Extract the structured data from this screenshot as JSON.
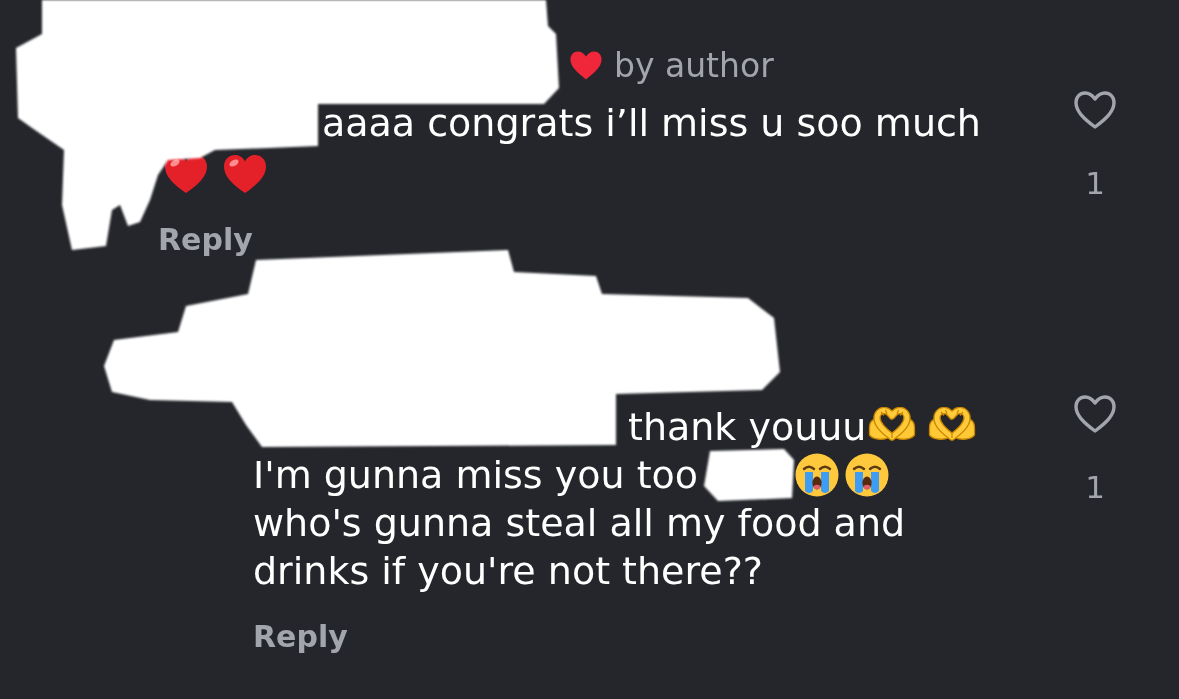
{
  "comments": [
    {
      "name_redacted": true,
      "liked_by_creator": true,
      "liked_by_creator_label": "by author",
      "lines": [
        {
          "segments": [
            {
              "kind": "redacted"
            },
            {
              "kind": "text",
              "text": "aaaa congrats i’ll miss u soo much"
            }
          ]
        },
        {
          "segments": [
            {
              "kind": "red-heart"
            },
            {
              "kind": "red-heart"
            }
          ]
        }
      ],
      "reply_label": "Reply",
      "liked": false,
      "like_count": "1",
      "replies": [
        {
          "name_redacted": true,
          "lines": [
            {
              "segments": [
                {
                  "kind": "redacted"
                },
                {
                  "kind": "text",
                  "text": "thank youuu"
                },
                {
                  "kind": "heart-hands"
                },
                {
                  "kind": "heart-hands"
                }
              ]
            },
            {
              "segments": [
                {
                  "kind": "text",
                  "text": "I'm gunna miss you too"
                },
                {
                  "kind": "redacted"
                },
                {
                  "kind": "crying-face"
                },
                {
                  "kind": "crying-face"
                }
              ]
            },
            {
              "segments": [
                {
                  "kind": "text",
                  "text": "who's gunna steal all my food and"
                }
              ]
            },
            {
              "segments": [
                {
                  "kind": "text",
                  "text": "drinks if you're not there??"
                }
              ]
            }
          ],
          "reply_label": "Reply",
          "liked": false,
          "like_count": "1"
        }
      ]
    }
  ]
}
